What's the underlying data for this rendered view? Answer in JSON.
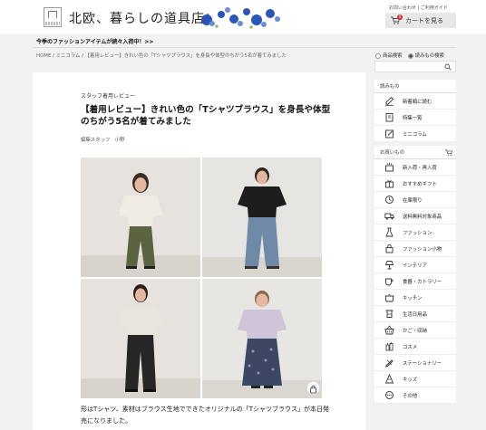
{
  "header": {
    "site_title": "北欧、暮らしの道具店",
    "links": "お問い合わせ | ご利用ガイド",
    "cart_label": "カートを見る",
    "cart_count": "0"
  },
  "promo": "今季のファッションアイテムが続々入荷中！>>",
  "breadcrumb": "HOME / ミニコラム / 【着用レビュー】きれい色の「Tシャツブラウス」を身長や体型のちがう5名が着てみました",
  "search": {
    "option_products": "商品検索",
    "option_articles": "読みもの検索",
    "placeholder": ""
  },
  "article": {
    "kicker": "スタッフ着用レビュー",
    "title": "【着用レビュー】きれい色の「Tシャツブラウス」を身長や体型のちがう5名が着てみました",
    "author": "編集スタッフ　小野",
    "body": "形はTシャツ、素材はブラウス生地でできたオリジナルの「Tシャツブラウス」が本日発売になりました。"
  },
  "sidebar": {
    "reading_heading": "読みもの",
    "reading_items": [
      {
        "label": "新着順に読む",
        "icon": "pencil-icon"
      },
      {
        "label": "特集一覧",
        "icon": "book-icon"
      },
      {
        "label": "ミニコラム",
        "icon": "note-icon"
      }
    ],
    "shop_heading": "お買いもの",
    "shop_items": [
      {
        "label": "新入荷・再入荷",
        "icon": "sparkle-box-icon"
      },
      {
        "label": "おすすめギフト",
        "icon": "gift-icon"
      },
      {
        "label": "在庫限り",
        "icon": "clock-icon"
      },
      {
        "label": "送料無料対象商品",
        "icon": "truck-icon"
      },
      {
        "label": "ファッション",
        "icon": "dress-icon"
      },
      {
        "label": "ファッション小物",
        "icon": "bag-icon"
      },
      {
        "label": "インテリア",
        "icon": "lamp-icon"
      },
      {
        "label": "食器・カトラリー",
        "icon": "cup-icon"
      },
      {
        "label": "キッチン",
        "icon": "pot-icon"
      },
      {
        "label": "生活日用品",
        "icon": "towel-icon"
      },
      {
        "label": "かご・収納",
        "icon": "basket-icon"
      },
      {
        "label": "コスメ",
        "icon": "bottle-icon"
      },
      {
        "label": "ステーショナリー",
        "icon": "pen-icon"
      },
      {
        "label": "キッズ",
        "icon": "toy-icon"
      },
      {
        "label": "その他",
        "icon": "more-icon"
      }
    ]
  },
  "colors": {
    "accent": "#c33333",
    "text": "#222222",
    "background": "#f2f2f2"
  }
}
